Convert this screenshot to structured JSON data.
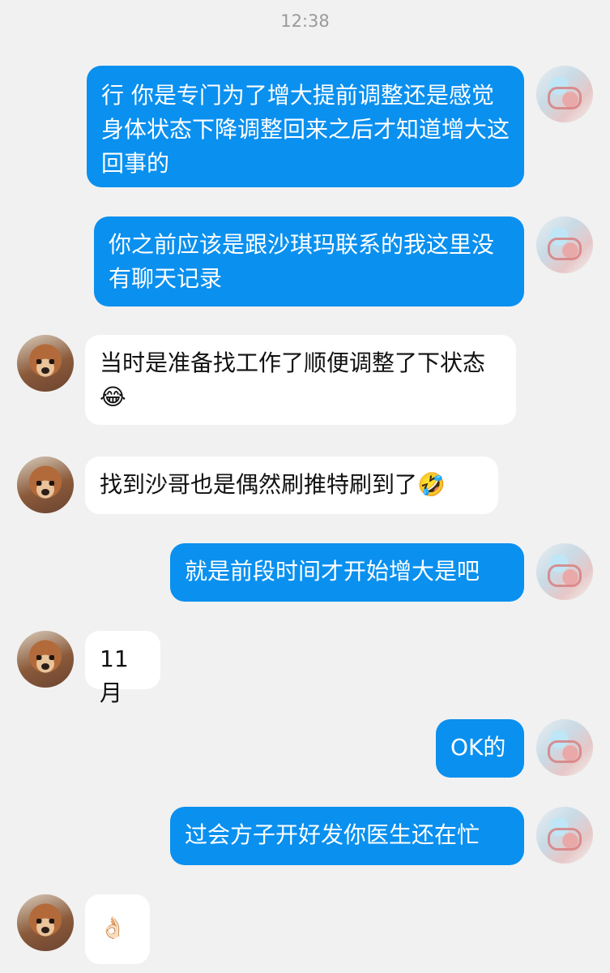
{
  "header": {
    "time": "12:38"
  },
  "messages": [
    {
      "side": "right",
      "text": "行 你是专门为了增大提前调整还是感觉身体状态下降调整回来之后才知道增大这回事的"
    },
    {
      "side": "right",
      "text": "你之前应该是跟沙琪玛联系的我这里没有聊天记录"
    },
    {
      "side": "left",
      "text": "当时是准备找工作了顺便调整了下状态😂"
    },
    {
      "side": "left",
      "text": "找到沙哥也是偶然刷推特刷到了🤣"
    },
    {
      "side": "right",
      "text": "就是前段时间才开始增大是吧"
    },
    {
      "side": "left",
      "text": "11月"
    },
    {
      "side": "right",
      "text": "OK的"
    },
    {
      "side": "right",
      "text": "过会方子开好发你医生还在忙"
    },
    {
      "side": "left",
      "text": "👌🏻"
    }
  ],
  "colors": {
    "outgoing": "#0a90ef",
    "incoming": "#ffffff",
    "background": "#f1f1f1"
  },
  "avatars": {
    "self": "user-avatar",
    "contact": "dog-avatar"
  }
}
